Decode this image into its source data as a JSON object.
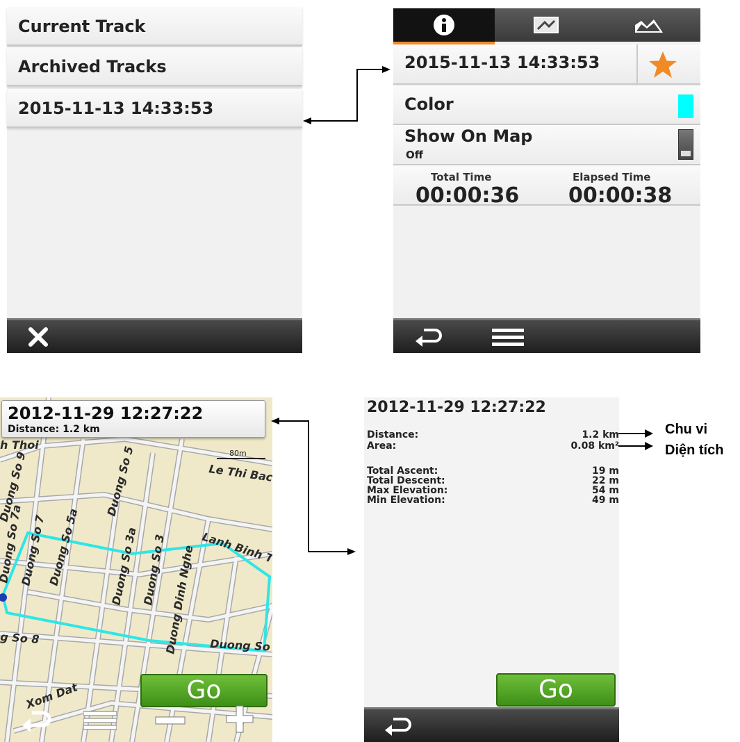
{
  "track_list": {
    "items": [
      "Current Track",
      "Archived Tracks",
      "2015-11-13 14:33:53"
    ],
    "close_icon": "close-icon"
  },
  "track_details": {
    "tabs": [
      "info-icon",
      "map-icon",
      "elevation-icon"
    ],
    "name": "2015-11-13 14:33:53",
    "favorite_icon": "star-icon",
    "color_label": "Color",
    "color_value": "#00ffff",
    "show_on_map_label": "Show On Map",
    "show_on_map_value": "Off",
    "total_time_label": "Total Time",
    "total_time_value": "00:00:36",
    "elapsed_time_label": "Elapsed Time",
    "elapsed_time_value": "00:00:38",
    "back_icon": "back-icon",
    "menu_icon": "menu-icon"
  },
  "map_view": {
    "title": "2012-11-29 12:27:22",
    "distance": "Distance: 1.2 km",
    "scale": "80m",
    "streets": [
      "h Thoi",
      "Le Thi Bac",
      "Duong So 9",
      "Duong So 5",
      "Duong So 7a",
      "Duong So 7",
      "Duong So 5a",
      "Lanh Binh T",
      "Duong So 3a",
      "Duong So 3",
      "Duong Dinh Nghe",
      "g So 8",
      "Duong So",
      "Xom Dat"
    ],
    "go_label": "Go",
    "controls": [
      "back-icon",
      "menu-icon",
      "zoom-out-icon",
      "zoom-in-icon"
    ]
  },
  "track_stats": {
    "title": "2012-11-29 12:27:22",
    "rows": [
      {
        "label": "Distance:",
        "value": "1.2 km"
      },
      {
        "label": "Area:",
        "value": "0.08 km²"
      },
      {
        "label": "Total Ascent:",
        "value": "19 m"
      },
      {
        "label": "Total Descent:",
        "value": "22 m"
      },
      {
        "label": "Max Elevation:",
        "value": "54 m"
      },
      {
        "label": "Min Elevation:",
        "value": "49 m"
      }
    ],
    "go_label": "Go",
    "back_icon": "back-icon"
  },
  "annotations": {
    "perimeter": "Chu vi",
    "area": "Diện tích"
  }
}
